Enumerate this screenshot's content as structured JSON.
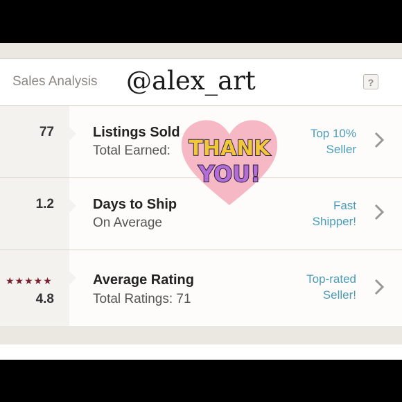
{
  "header": {
    "title": "Sales Analysis",
    "handle": "@alex_art",
    "help": "?"
  },
  "rows": [
    {
      "stat": "77",
      "label": "Listings Sold",
      "sub": "Total Earned:",
      "badge_line1": "Top 10%",
      "badge_line2": "Seller"
    },
    {
      "stat": "1.2",
      "label": "Days to Ship",
      "sub": "On Average",
      "badge_line1": "Fast",
      "badge_line2": "Shipper!"
    },
    {
      "stat": "4.8",
      "label": "Average Rating",
      "sub": "Total Ratings: 71",
      "badge_line1": "Top-rated",
      "badge_line2": "Seller!",
      "stars": "★★★★★"
    }
  ],
  "sticker": {
    "line1": "THANK",
    "line2": "YOU!"
  },
  "colors": {
    "badge": "#4a9cb8",
    "stars": "#7a1f2b",
    "heart": "#f6b8c4",
    "background": "#ebe8e2"
  }
}
